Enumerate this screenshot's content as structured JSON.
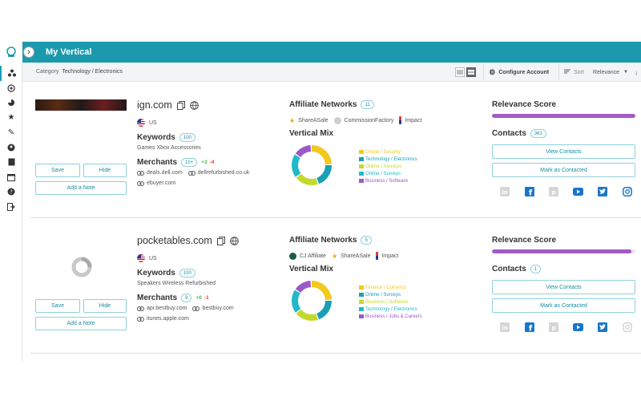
{
  "header": {
    "title": "My Vertical"
  },
  "subbar": {
    "category_label": "Category",
    "category_value": "Technology / Electronics",
    "configure_label": "Configure Account",
    "sort_label": "Sort",
    "sort_value": "Relevance"
  },
  "cards": [
    {
      "domain": "ign.com",
      "country": "US",
      "keywords_label": "Keywords",
      "keywords_count": "100",
      "keywords": "Games  Xbox  Accessories",
      "merchants_label": "Merchants",
      "merchants_count": "10+",
      "merchants_plus": "+3",
      "merchants_minus": "-4",
      "merchant_links": [
        "deals.dell.com",
        "dellrefurbished.co.uk",
        "ebuyer.com"
      ],
      "networks_label": "Affiliate Networks",
      "networks_count": "11",
      "networks": [
        "ShareASale",
        "CommissionFactory",
        "Impact"
      ],
      "mix_label": "Vertical Mix",
      "mix": [
        {
          "label": "Online / Security",
          "color": "#f2c91d",
          "value": 25
        },
        {
          "label": "Technology / Electronics",
          "color": "#1aa0b5",
          "value": 20
        },
        {
          "label": "Online / Services",
          "color": "#c4d92e",
          "value": 20
        },
        {
          "label": "Online / Surveys",
          "color": "#22b8c9",
          "value": 20
        },
        {
          "label": "Business / Software",
          "color": "#9b59c7",
          "value": 15
        }
      ],
      "relevance_label": "Relevance Score",
      "relevance": 1.0,
      "contacts_label": "Contacts",
      "contacts_count": "361",
      "view_contacts": "View Contacts",
      "mark_contacted": "Mark as Contacted",
      "save": "Save",
      "hide": "Hide",
      "add_note": "Add a Note"
    },
    {
      "domain": "pocketables.com",
      "country": "US",
      "keywords_label": "Keywords",
      "keywords_count": "100",
      "keywords": "Speakers  Wireless  Refurbished",
      "merchants_label": "Merchants",
      "merchants_count": "9",
      "merchants_plus": "+0",
      "merchants_minus": "-1",
      "merchant_links": [
        "api.bestbuy.com",
        "bestbuy.com",
        "itunes.apple.com"
      ],
      "networks_label": "Affiliate Networks",
      "networks_count": "5",
      "networks": [
        "CJ Affiliate",
        "ShareASale",
        "Impact"
      ],
      "mix_label": "Vertical Mix",
      "mix": [
        {
          "label": "Finance / Currency",
          "color": "#f2c91d",
          "value": 25
        },
        {
          "label": "Online / Surveys",
          "color": "#1aa0b5",
          "value": 20
        },
        {
          "label": "Business / Software",
          "color": "#c4d92e",
          "value": 20
        },
        {
          "label": "Technology / Electronics",
          "color": "#22b8c9",
          "value": 20
        },
        {
          "label": "Business / Jobs & Careers",
          "color": "#9b59c7",
          "value": 15
        }
      ],
      "relevance_label": "Relevance Score",
      "relevance": 0.97,
      "contacts_label": "Contacts",
      "contacts_count": "1",
      "view_contacts": "View Contacts",
      "mark_contacted": "Mark as Contacted",
      "save": "Save",
      "hide": "Hide",
      "add_note": "Add a Note"
    }
  ],
  "colors": {
    "accent": "#1b9aae",
    "relevance": "#a25bc7"
  },
  "icons": [
    "logo-icon",
    "network-icon",
    "target-icon",
    "pie-icon",
    "star-icon",
    "pencil-icon",
    "user-icon",
    "book-icon",
    "calendar-icon",
    "help-icon",
    "logout-icon"
  ]
}
